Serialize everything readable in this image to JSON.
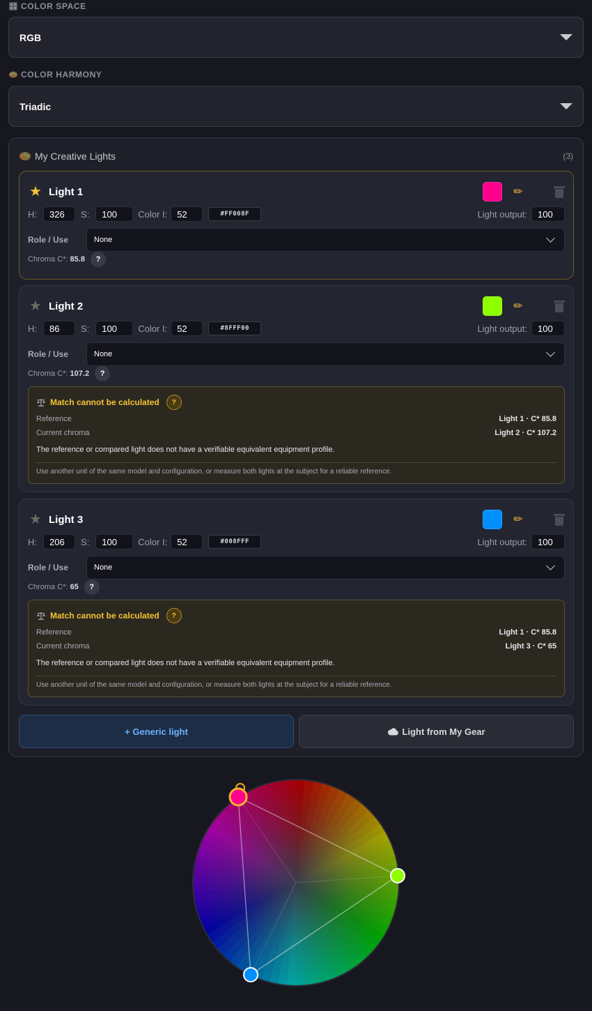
{
  "color_space": {
    "label": "COLOR SPACE",
    "value": "RGB"
  },
  "color_harmony": {
    "label": "COLOR HARMONY",
    "value": "Triadic"
  },
  "panel": {
    "title": "My Creative Lights",
    "count": "(3)"
  },
  "labels": {
    "h": "H:",
    "s": "S:",
    "color_i": "Color I:",
    "light_output": "Light output:",
    "role": "Role / Use",
    "chroma": "Chroma C*:",
    "q": "?"
  },
  "lights": [
    {
      "name": "Light 1",
      "h": "326",
      "s": "100",
      "i": "52",
      "hex": "#FF008F",
      "output": "100",
      "role": "None",
      "chroma": "85.8",
      "color": "#ff008f"
    },
    {
      "name": "Light 2",
      "h": "86",
      "s": "100",
      "i": "52",
      "hex": "#8FFF00",
      "output": "100",
      "role": "None",
      "chroma": "107.2",
      "color": "#8fff00",
      "warning": {
        "title": "Match cannot be calculated",
        "reference_label": "Reference",
        "reference_value": "Light 1 · C* 85.8",
        "current_label": "Current chroma",
        "current_value": "Light 2 · C* 107.2",
        "message": "The reference or compared light does not have a verifiable equivalent equipment profile.",
        "note": "Use another unit of the same model and configuration, or measure both lights at the subject for a reliable reference."
      }
    },
    {
      "name": "Light 3",
      "h": "206",
      "s": "100",
      "i": "52",
      "hex": "#008FFF",
      "output": "100",
      "role": "None",
      "chroma": "65",
      "color": "#008fff",
      "warning": {
        "title": "Match cannot be calculated",
        "reference_label": "Reference",
        "reference_value": "Light 1 · C* 85.8",
        "current_label": "Current chroma",
        "current_value": "Light 3 · C* 65",
        "message": "The reference or compared light does not have a verifiable equivalent equipment profile.",
        "note": "Use another unit of the same model and configuration, or measure both lights at the subject for a reliable reference."
      }
    }
  ],
  "buttons": {
    "generic": "+ Generic light",
    "gear": "Light from My Gear"
  },
  "colors": {
    "accent_blue": "#6ab2ff",
    "warning": "#f6c232"
  }
}
